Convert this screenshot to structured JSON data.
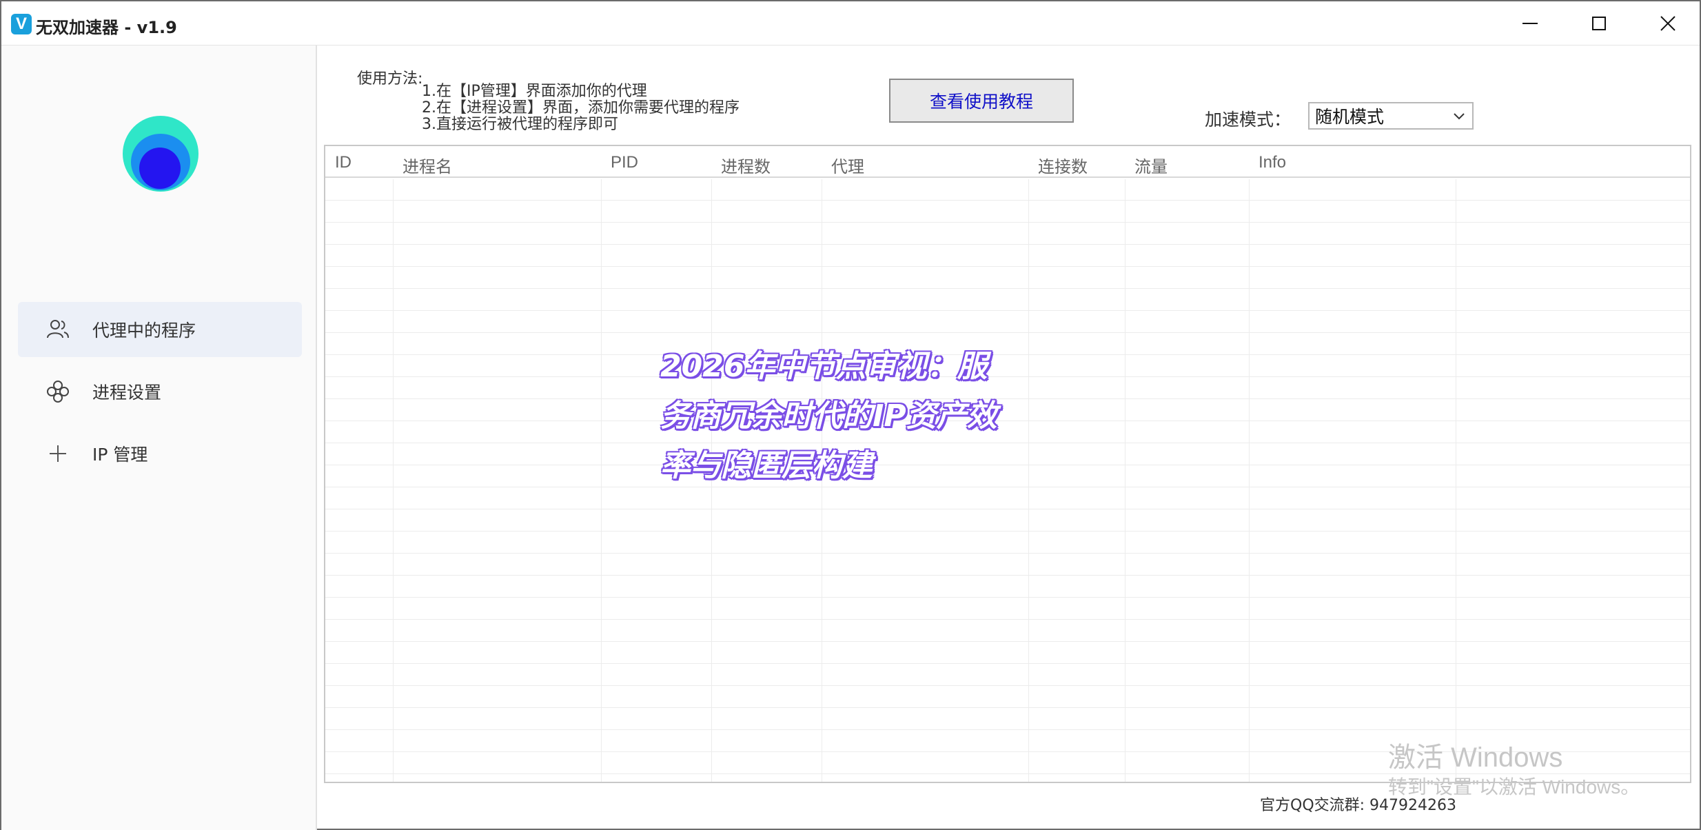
{
  "window": {
    "title": "无双加速器 - v1.9",
    "logo_letter": "V"
  },
  "sidebar": {
    "avatar_icon": "circle-logo",
    "items": [
      {
        "label": "代理中的程序",
        "icon": "users-icon",
        "active": true
      },
      {
        "label": "进程设置",
        "icon": "clover-icon",
        "active": false
      },
      {
        "label": "IP 管理",
        "icon": "plus-icon",
        "active": false
      }
    ]
  },
  "usage": {
    "title": "使用方法:",
    "steps": [
      "1.在【IP管理】界面添加你的代理",
      "2.在【进程设置】界面，添加你需要代理的程序",
      "3.直接运行被代理的程序即可"
    ]
  },
  "toolbar": {
    "tutorial_button": "查看使用教程",
    "mode_label": "加速模式：",
    "mode_value": "随机模式"
  },
  "table": {
    "columns": [
      "ID",
      "进程名",
      "PID",
      "进程数",
      "代理",
      "连接数",
      "流量",
      "Info"
    ],
    "rows": []
  },
  "overlay_text": {
    "line1": "2026年中节点审视：服",
    "line2": "务商冗余时代的IP资产效",
    "line3": "率与隐匿层构建"
  },
  "footer": {
    "qq_group": "官方QQ交流群: 947924263"
  },
  "watermark": {
    "title": "激活 Windows",
    "subtitle": "转到\"设置\"以激活 Windows。"
  },
  "colors": {
    "accent": "#1010c8",
    "overlay_outline": "#7a4ee6",
    "active_nav": "#ecf0f8"
  }
}
